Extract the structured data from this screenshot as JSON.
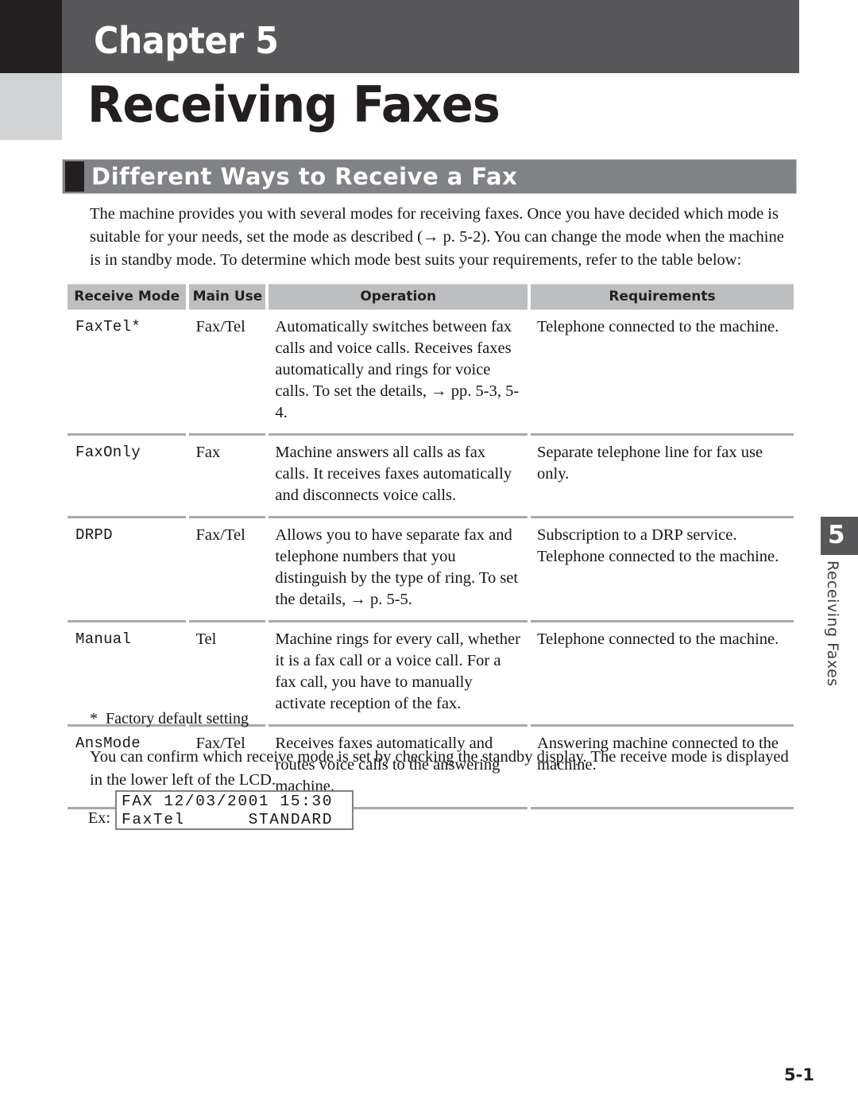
{
  "chapter": {
    "label": "Chapter 5",
    "title": "Receiving Faxes"
  },
  "section": {
    "title": "Different Ways to Receive a Fax"
  },
  "intro_paragraph": "The machine provides you with several modes for receiving faxes. Once you have decided which mode is suitable for your needs, set the mode as described (→ p. 5-2). You can change the mode when the machine is in standby mode. To determine which mode best suits your requirements, refer to the table below:",
  "table": {
    "headers": {
      "receive_mode": "Receive Mode",
      "main_use": "Main Use",
      "operation": "Operation",
      "requirements": "Requirements"
    },
    "rows": [
      {
        "mode": "FaxTel*",
        "use": "Fax/Tel",
        "operation": "Automatically switches between fax calls and voice calls. Receives faxes automatically and rings for voice calls. To set the details, → pp. 5-3, 5-4.",
        "requirements": "Telephone connected to the machine."
      },
      {
        "mode": "FaxOnly",
        "use": "Fax",
        "operation": "Machine answers all calls as fax calls. It receives faxes automatically and disconnects voice calls.",
        "requirements": "Separate telephone line for fax use only."
      },
      {
        "mode": "DRPD",
        "use": "Fax/Tel",
        "operation": "Allows you to have separate fax and telephone numbers that you distinguish by the type of ring. To set the details, → p. 5-5.",
        "requirements": "Subscription to a DRP service. Telephone connected to the machine."
      },
      {
        "mode": "Manual",
        "use": "Tel",
        "operation": "Machine rings for every call, whether it is a fax call or a voice call. For a fax call, you have to manually activate reception of the fax.",
        "requirements": "Telephone connected to the machine."
      },
      {
        "mode": "AnsMode",
        "use": "Fax/Tel",
        "operation": "Receives faxes automatically and routes voice calls to the answering machine.",
        "requirements": "Answering machine connected to the machine."
      }
    ]
  },
  "footnote": {
    "marker": "*",
    "text": "Factory default setting"
  },
  "confirm_paragraph": "You can confirm which receive mode is set by checking the standby display. The receive mode is displayed in the lower left of the LCD.",
  "lcd_example": {
    "label": "Ex:",
    "line1": "FAX 12/03/2001 15:30",
    "line2": "FaxTel      STANDARD"
  },
  "side_tab": {
    "number": "5",
    "text": "Receiving Faxes"
  },
  "page_number": "5-1",
  "colors": {
    "chapter_band": "#58585a",
    "chapter_black": "#231f20",
    "chapter_gray": "#d1d3d4",
    "section_bar": "#808285",
    "table_header": "#bcbec0",
    "rule": "#a7a9ac"
  }
}
